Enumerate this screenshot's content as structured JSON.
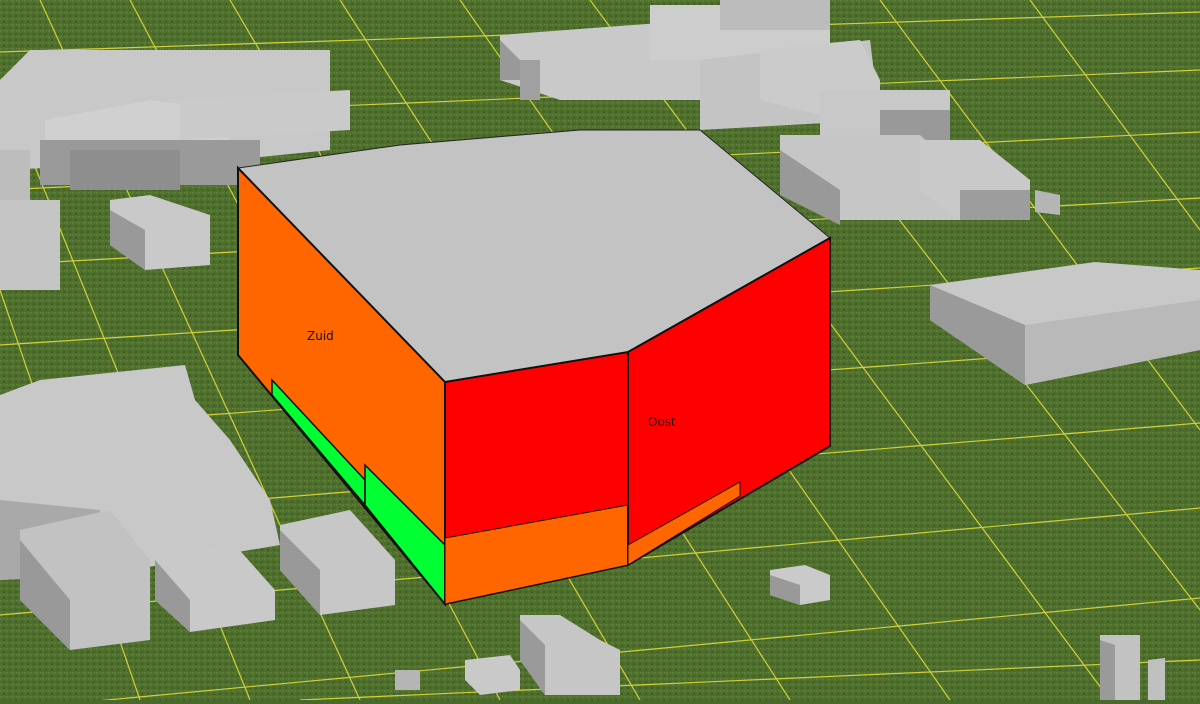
{
  "scene": {
    "facade_labels": {
      "south": "Zuid",
      "east": "Oost"
    },
    "colors": {
      "ground": "#4d6e2e",
      "ground_dark": "#3f5d24",
      "grid_lines": "#e8e23a",
      "buildings_top": "#c8c8c8",
      "buildings_side": "#9a9a9a",
      "roof": "#c3c3c3",
      "facade_orange": "#ff6600",
      "facade_red": "#ff0000",
      "facade_green": "#00ff33",
      "outline": "#111111"
    }
  }
}
